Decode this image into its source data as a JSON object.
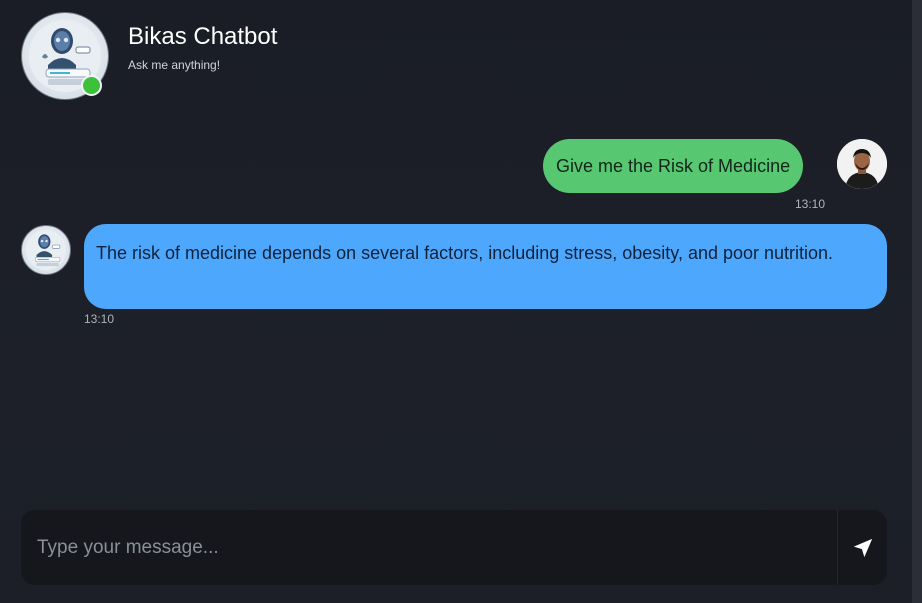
{
  "header": {
    "title": "Bikas Chatbot",
    "subtitle": "Ask me anything!",
    "status": "online",
    "status_color": "#3cc13b"
  },
  "messages": [
    {
      "sender": "user",
      "text": "Give me the Risk of Medicine",
      "time": "13:10",
      "bubble_color": "#57c772"
    },
    {
      "sender": "bot",
      "text": "The risk of medicine depends on several factors, including stress, obesity, and poor nutrition.",
      "time": "13:10",
      "bubble_color": "#4da8fd"
    }
  ],
  "composer": {
    "placeholder": "Type your message...",
    "value": "",
    "send_icon": "send-arrow-icon"
  },
  "theme": {
    "background": "#1c1f27",
    "input_background": "#15171d"
  }
}
